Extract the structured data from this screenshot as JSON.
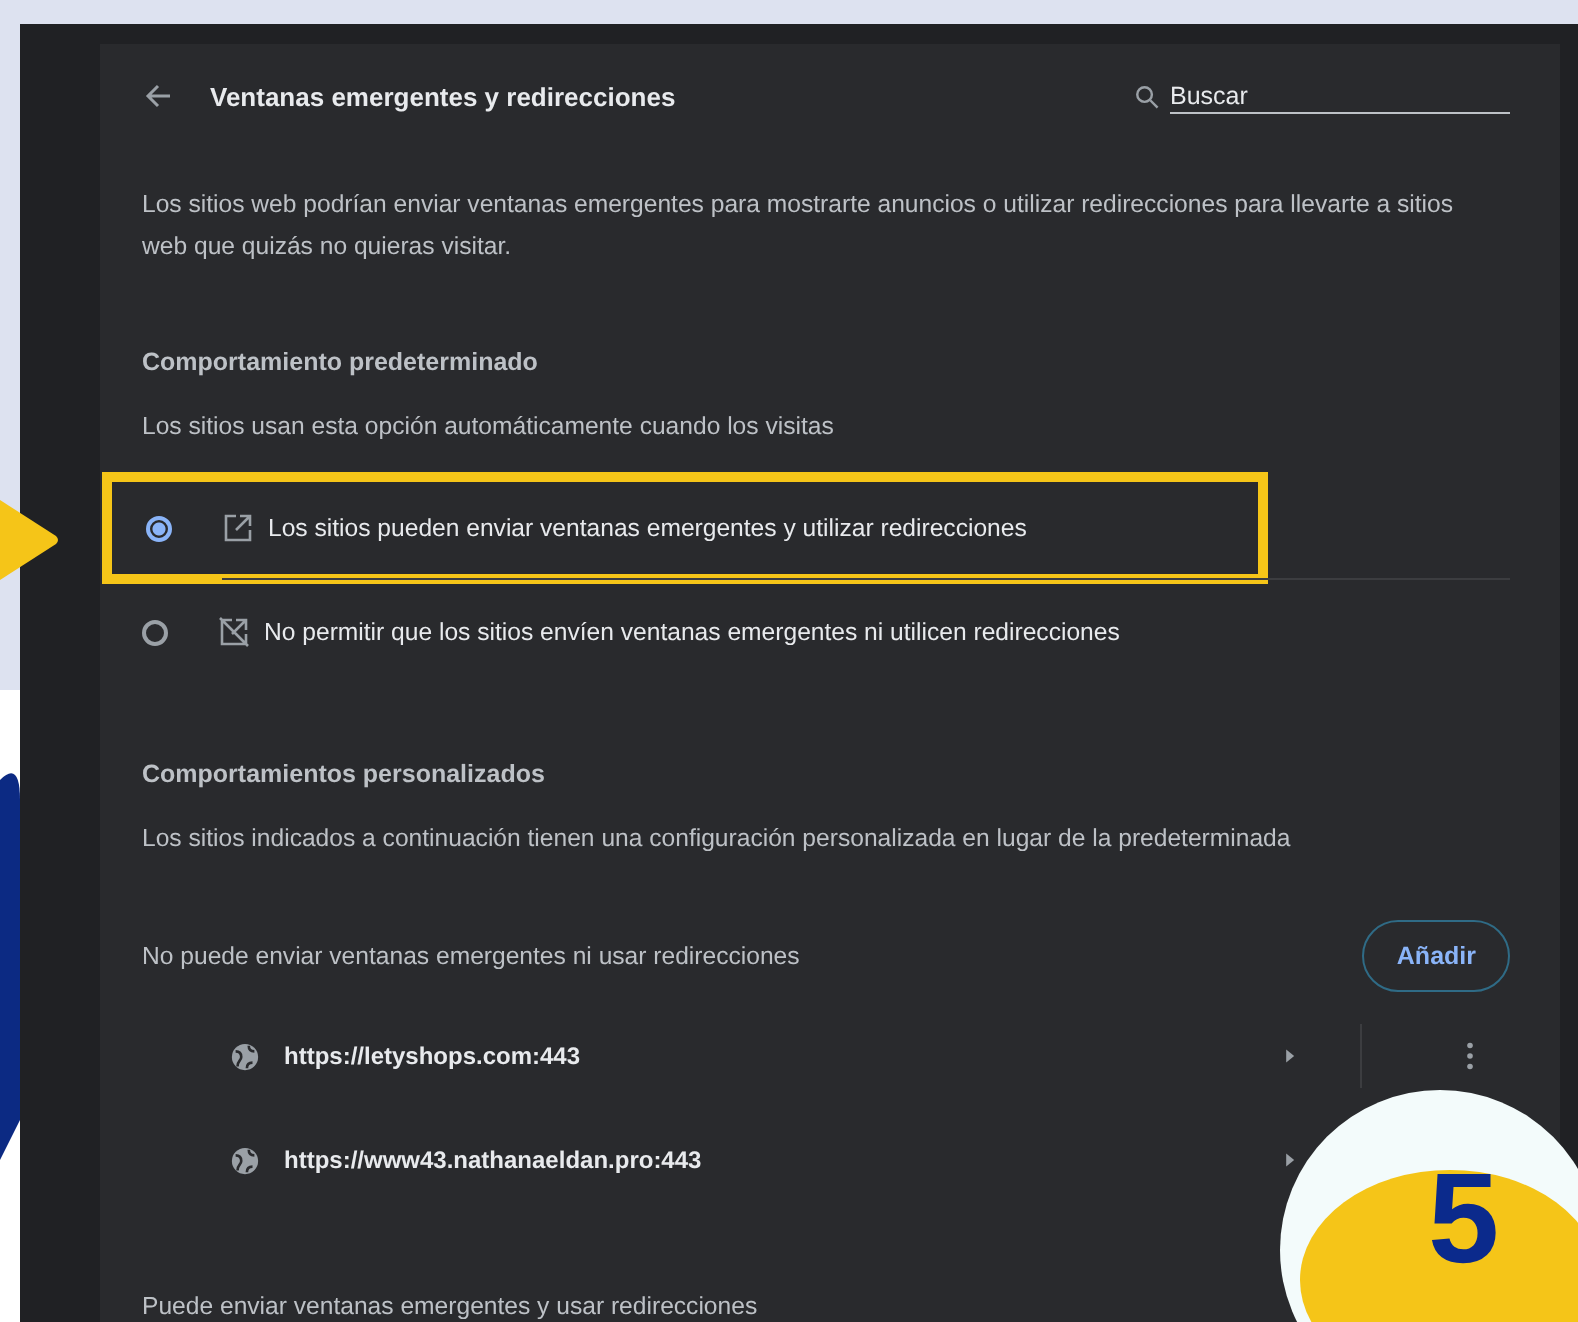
{
  "header": {
    "title": "Ventanas emergentes y redirecciones",
    "search": {
      "placeholder": "Buscar"
    }
  },
  "intro": "Los sitios web podrían enviar ventanas emergentes para mostrarte anuncios o utilizar redirecciones para llevarte a sitios web que quizás no quieras visitar.",
  "default_behavior": {
    "heading": "Comportamiento predeterminado",
    "description": "Los sitios usan esta opción automáticamente cuando los visitas",
    "options": [
      {
        "label": "Los sitios pueden enviar ventanas emergentes y utilizar redirecciones",
        "selected": true,
        "kind": "allow",
        "highlighted": true
      },
      {
        "label": "No permitir que los sitios envíen ventanas emergentes ni utilicen redirecciones",
        "selected": false,
        "kind": "block",
        "highlighted": false
      }
    ]
  },
  "custom_behaviors": {
    "heading": "Comportamientos personalizados",
    "description": "Los sitios indicados a continuación tienen una configuración personalizada en lugar de la predeterminada",
    "blocked": {
      "label": "No puede enviar ventanas emergentes ni usar redirecciones",
      "add_button": "Añadir",
      "sites": [
        {
          "url": "https://letyshops.com:443"
        },
        {
          "url": "https://www43.nathanaeldan.pro:443"
        }
      ]
    },
    "allowed": {
      "label": "Puede enviar ventanas emergentes y usar redirecciones"
    }
  },
  "step_badge": "5"
}
